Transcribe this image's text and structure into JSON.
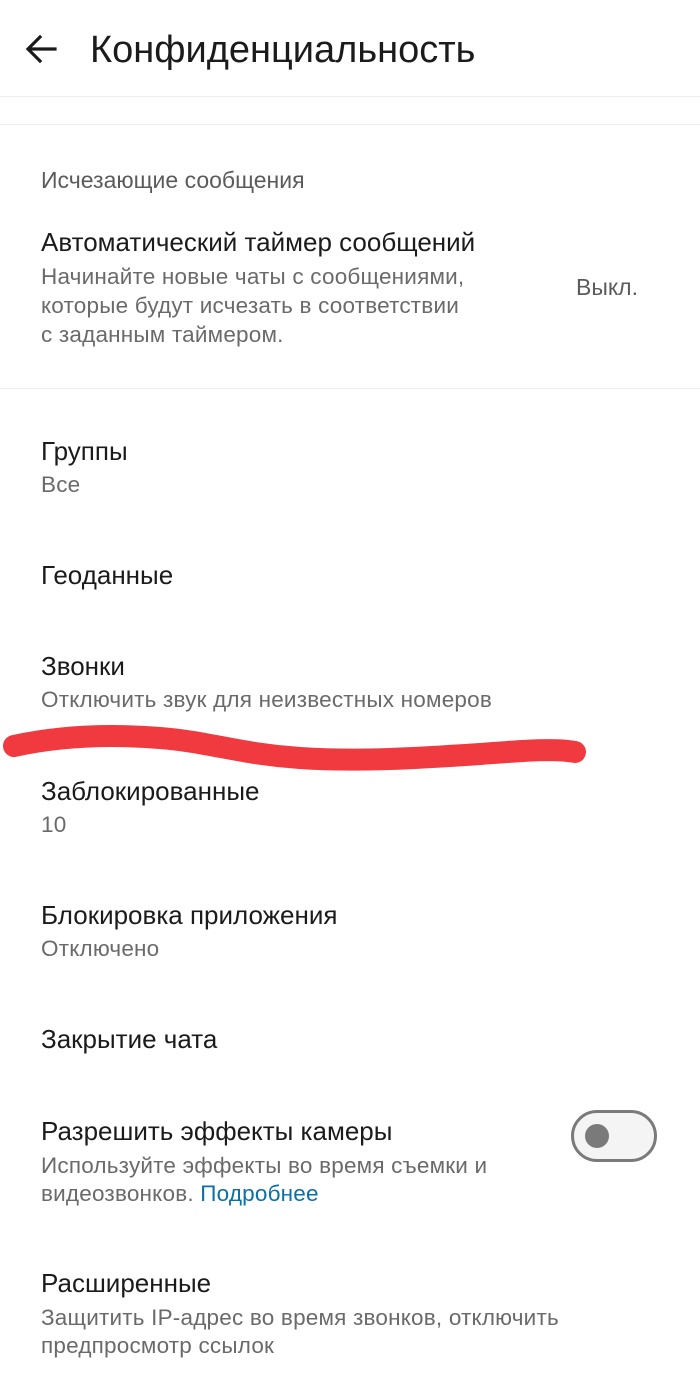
{
  "header": {
    "back_icon": "arrow-left-icon",
    "title": "Конфиденциальность"
  },
  "disappearing": {
    "section_label": "Исчезающие сообщения",
    "timer_title": "Автоматический таймер сообщений",
    "timer_description_lines": [
      "Начинайте новые чаты с сообщениями,",
      "которые будут исчезать в соответствии",
      "с заданным таймером."
    ],
    "timer_value": "Выкл."
  },
  "settings": {
    "groups": {
      "title": "Группы",
      "value": "Все"
    },
    "location": {
      "title": "Геоданные"
    },
    "calls": {
      "title": "Звонки",
      "value": "Отключить звук для неизвестных номеров"
    },
    "blocked": {
      "title": "Заблокированные",
      "value": "10"
    },
    "app_lock": {
      "title": "Блокировка приложения",
      "value": "Отключено"
    },
    "chat_lock": {
      "title": "Закрытие чата"
    },
    "camera_effects": {
      "title": "Разрешить эффекты камеры",
      "description_line1": "Используйте эффекты во время съемки и",
      "description_line2": "видеозвонков.",
      "learn_more": "Подробнее",
      "enabled": false
    },
    "advanced": {
      "title": "Расширенные",
      "description_line1": "Защитить IP-адрес во время звонков, отключить",
      "description_line2": "предпросмотр ссылок"
    }
  },
  "colors": {
    "link": "#0b6fa8",
    "annotation_scribble": "#f03a3f",
    "toggle_off": "#7a7a7a"
  }
}
